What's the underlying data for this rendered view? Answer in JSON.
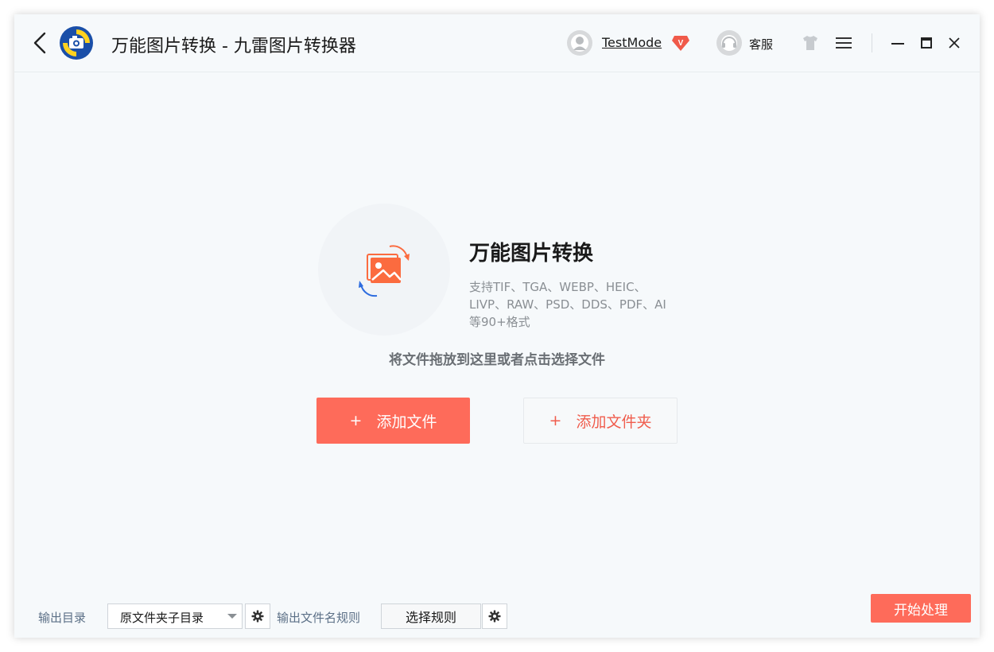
{
  "titlebar": {
    "title": "万能图片转换 - 九雷图片转换器",
    "username": "TestMode",
    "vip_letter": "V",
    "service_label": "客服"
  },
  "feature": {
    "title": "万能图片转换",
    "description": "支持TIF、TGA、WEBP、HEIC、LIVP、RAW、PSD、DDS、PDF、AI等90+格式"
  },
  "drop_hint": "将文件拖放到这里或者点击选择文件",
  "buttons": {
    "add_file": "添加文件",
    "add_folder": "添加文件夹",
    "plus": "+"
  },
  "bottom": {
    "output_dir_label": "输出目录",
    "output_dir_value": "原文件夹子目录",
    "name_rule_label": "输出文件名规则",
    "choose_rule": "选择规则",
    "start": "开始处理"
  },
  "colors": {
    "accent": "#fe6b5a",
    "label_blue": "#5c7087"
  }
}
